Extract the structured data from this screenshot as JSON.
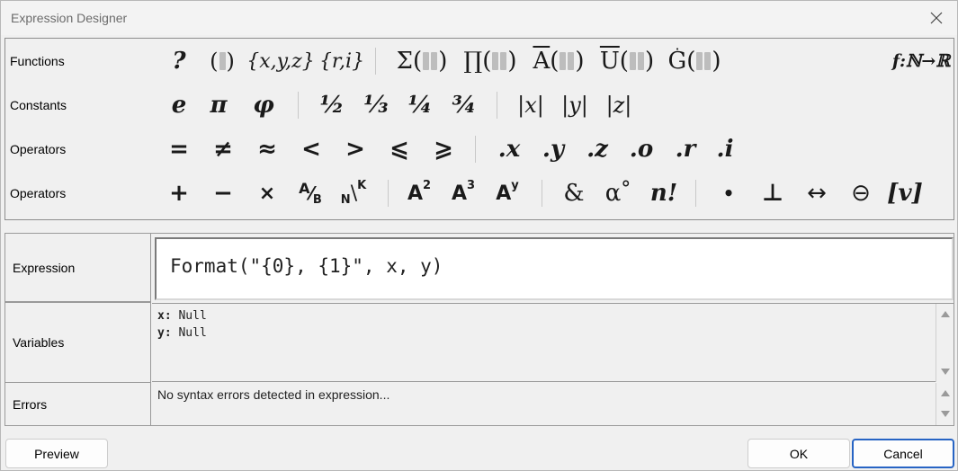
{
  "window": {
    "title": "Expression Designer"
  },
  "palette": {
    "rows": [
      {
        "label": "Functions"
      },
      {
        "label": "Constants"
      },
      {
        "label": "Operators"
      },
      {
        "label": "Operators"
      }
    ],
    "functions": {
      "question": "?",
      "set": "{x,y,z}",
      "polar": "{r,i}",
      "sum": "Σ",
      "product": "∏",
      "mean": "A",
      "union": "U",
      "gradient": "G",
      "map": "f:ℕ→ℝ"
    },
    "constants": {
      "e": "e",
      "pi": "π",
      "phi": "φ",
      "half": "½",
      "third": "⅓",
      "quarter": "¼",
      "three_quarters": "¾",
      "abs_x": "|x|",
      "abs_y": "|y|",
      "abs_z": "|z|"
    },
    "operators": {
      "eq": "=",
      "neq": "≠",
      "approx": "≈",
      "lt": "<",
      "gt": ">",
      "le": "⩽",
      "ge": "⩾",
      "dot_x": ".x",
      "dot_y": ".y",
      "dot_z": ".z",
      "dot_o": ".o",
      "dot_r": ".r",
      "dot_i": ".i"
    },
    "operators2": {
      "plus": "+",
      "minus": "−",
      "times": "×",
      "frac_a": "A",
      "frac_b": "B",
      "frac_slash": "⁄",
      "nk_n": "N",
      "nk_k": "K",
      "pow_base": "A",
      "pow2": "2",
      "pow3": "3",
      "powy": "y",
      "amp": "&",
      "alpha": "α",
      "degree": "°",
      "fact": "n!",
      "bullet": "•",
      "perp": "⊥",
      "arrow": "↔",
      "ominus": "⊖",
      "vec": "[v]"
    }
  },
  "grid": {
    "expression_label": "Expression",
    "expression_value": "Format(\"{0}, {1}\", x, y)",
    "variables_label": "Variables",
    "variables": [
      {
        "name": "x",
        "value": "Null"
      },
      {
        "name": "y",
        "value": "Null"
      }
    ],
    "errors_label": "Errors",
    "errors_value": "No syntax errors detected in expression..."
  },
  "buttons": {
    "preview": "Preview",
    "ok": "OK",
    "cancel": "Cancel"
  }
}
